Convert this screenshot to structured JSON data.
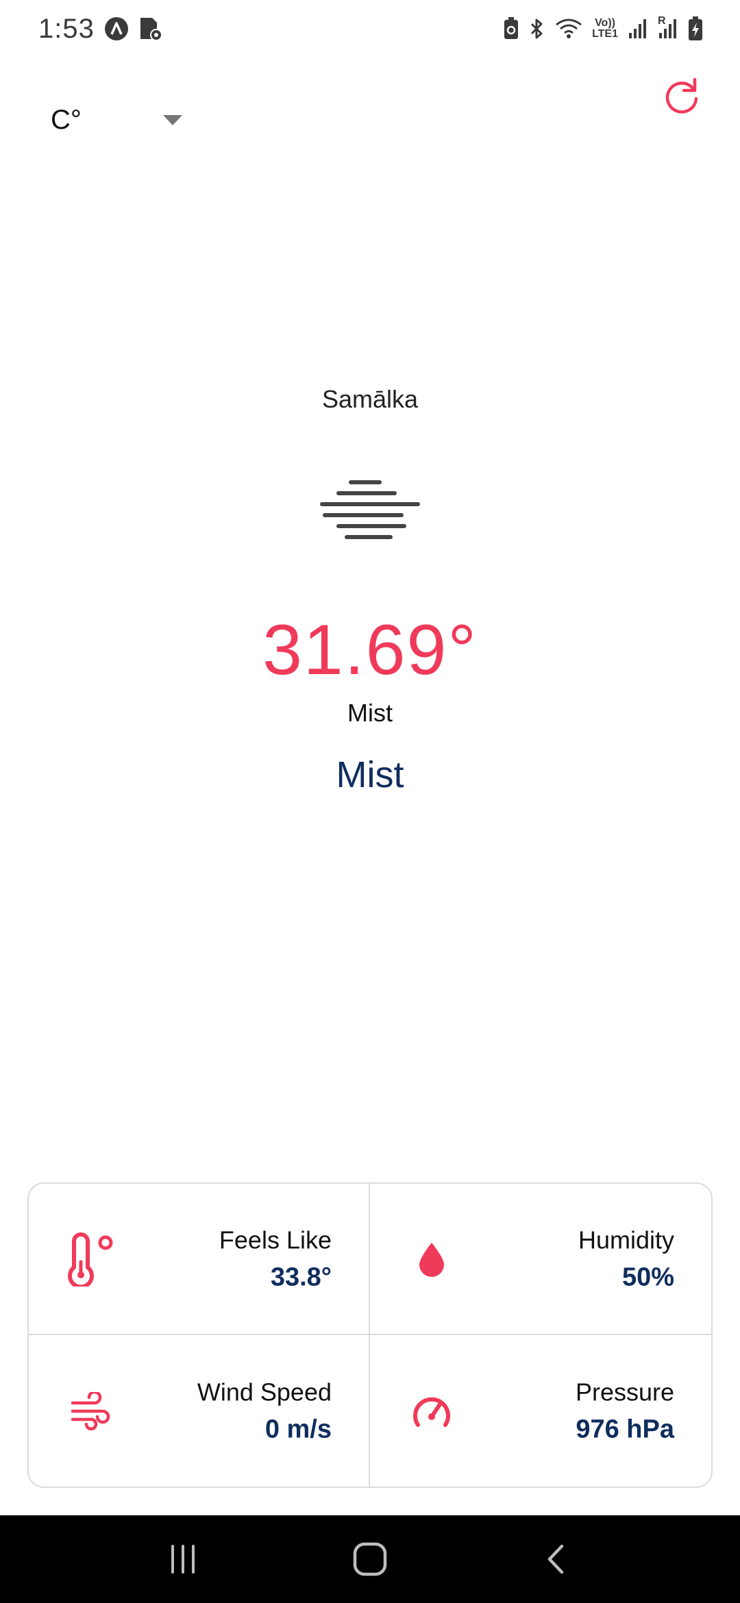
{
  "status_bar": {
    "time": "1:53",
    "volte_top": "Vo))",
    "volte_bottom": "LTE1",
    "roaming": "R"
  },
  "top_bar": {
    "unit_selected": "C°"
  },
  "weather": {
    "city": "Samālka",
    "temperature": "31.69°",
    "description_small": "Mist",
    "description_large": "Mist"
  },
  "stats": [
    {
      "label": "Feels Like",
      "value": "33.8°",
      "icon": "thermometer-icon"
    },
    {
      "label": "Humidity",
      "value": "50%",
      "icon": "water-drop-icon"
    },
    {
      "label": "Wind Speed",
      "value": "0 m/s",
      "icon": "wind-icon"
    },
    {
      "label": "Pressure",
      "value": "976 hPa",
      "icon": "gauge-icon"
    }
  ],
  "colors": {
    "accent": "#f03a5a",
    "navy": "#0f2d5e",
    "border": "#dcdcdc"
  }
}
